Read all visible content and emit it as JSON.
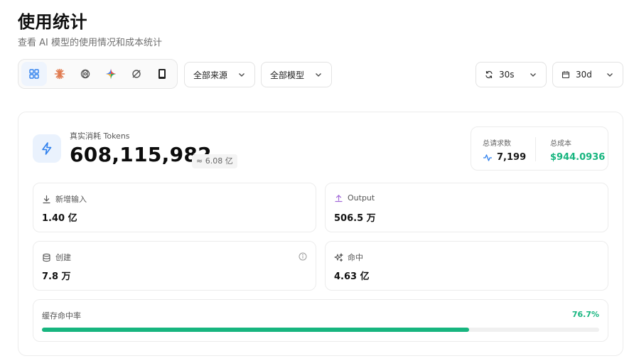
{
  "page": {
    "title": "使用统计",
    "subtitle": "查看 AI 模型的使用情况和成本统计"
  },
  "provider_icons": [
    {
      "name": "grid-icon",
      "active": true
    },
    {
      "name": "claude-icon",
      "active": false
    },
    {
      "name": "openai-icon",
      "active": false
    },
    {
      "name": "gemini-icon",
      "active": false
    },
    {
      "name": "ring-icon",
      "active": false
    },
    {
      "name": "device-icon",
      "active": false
    }
  ],
  "filters": {
    "source": "全部来源",
    "model": "全部模型",
    "refresh": "30s",
    "range": "30d"
  },
  "tokens": {
    "label": "真实消耗 Tokens",
    "value": "608,115,982",
    "approx": "≈ 6.08 亿"
  },
  "summary": {
    "requests_label": "总请求数",
    "requests_value": "7,199",
    "cost_label": "总成本",
    "cost_value": "$944.0936"
  },
  "stats": {
    "input_label": "新增输入",
    "input_value": "1.40 亿",
    "output_label": "Output",
    "output_value": "506.5 万",
    "create_label": "创建",
    "create_value": "7.8 万",
    "hit_label": "命中",
    "hit_value": "4.63 亿"
  },
  "cache": {
    "label": "缓存命中率",
    "percent_text": "76.7%",
    "percent": 76.7
  },
  "colors": {
    "accent_blue": "#2f80ed",
    "green": "#17b57f",
    "purple": "#a36bd9"
  }
}
